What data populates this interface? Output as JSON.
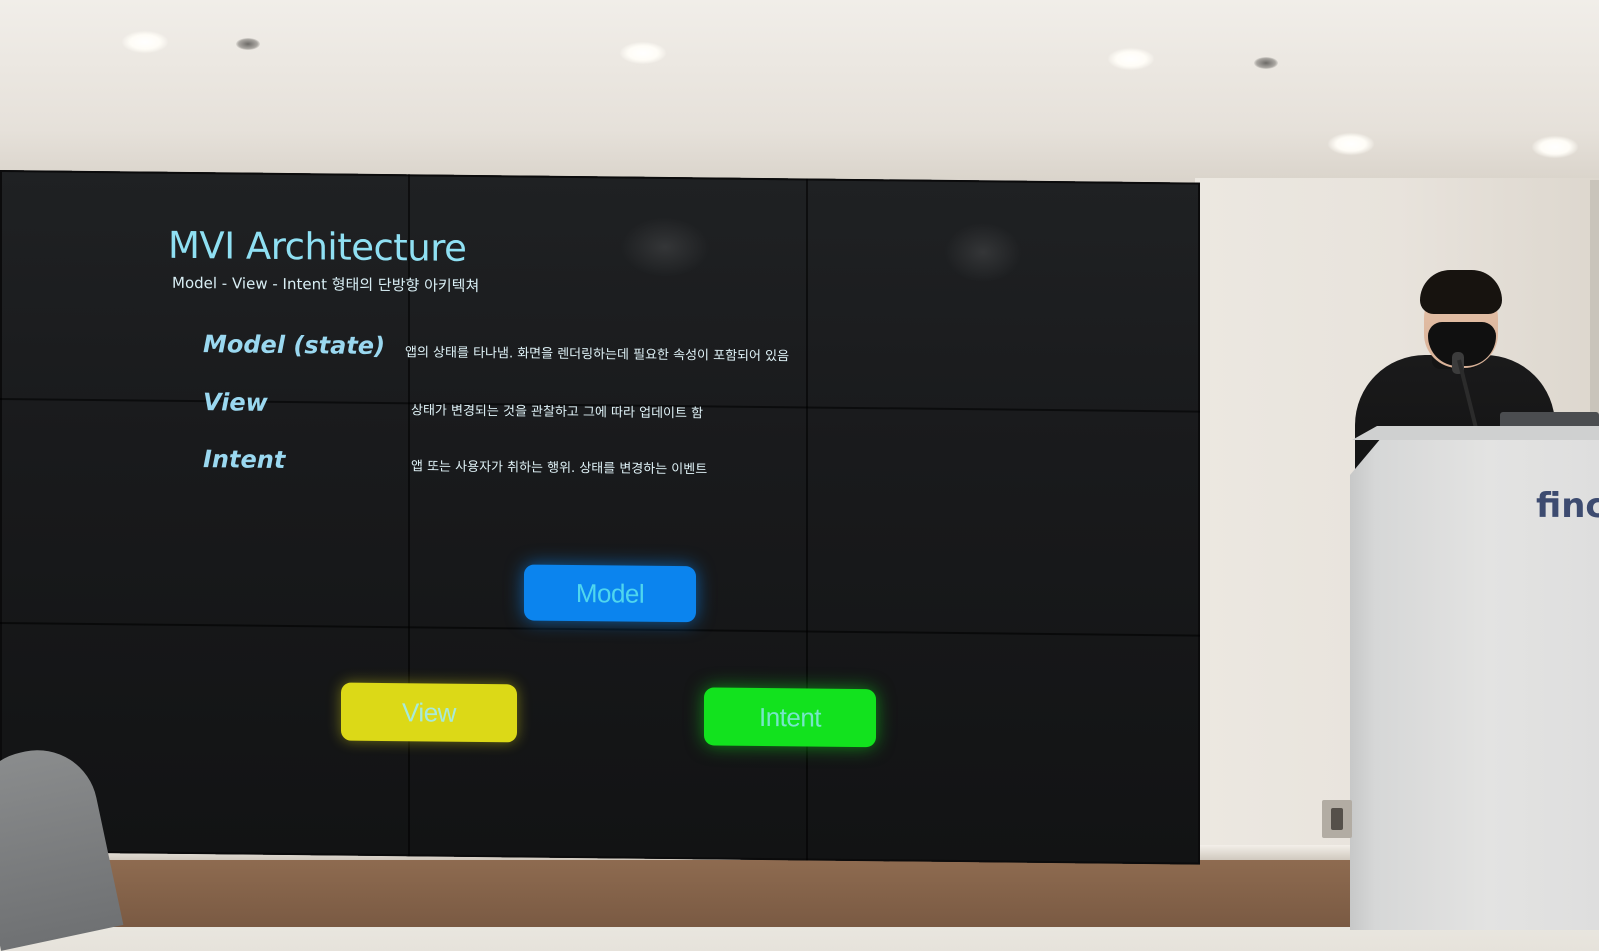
{
  "slide": {
    "title": "MVI Architecture",
    "subtitle": "Model - View - Intent 형태의 단방향 아키텍쳐",
    "definitions": [
      {
        "term": "Model (state)",
        "description": "앱의 상태를 타나냄. 화면을 렌더링하는데 필요한 속성이 포함되어 있음"
      },
      {
        "term": "View",
        "description": "상태가 변경되는 것을 관찰하고 그에 따라 업데이트 함"
      },
      {
        "term": "Intent",
        "description": "앱 또는 사용자가 취하는 행위. 상태를 변경하는 이벤트"
      }
    ],
    "diagram_boxes": {
      "model": {
        "label": "Model",
        "color": "#0b84ee"
      },
      "view": {
        "label": "View",
        "color": "#dcd917"
      },
      "intent": {
        "label": "Intent",
        "color": "#12e21e"
      }
    }
  },
  "podium": {
    "logo_text": "finc"
  }
}
